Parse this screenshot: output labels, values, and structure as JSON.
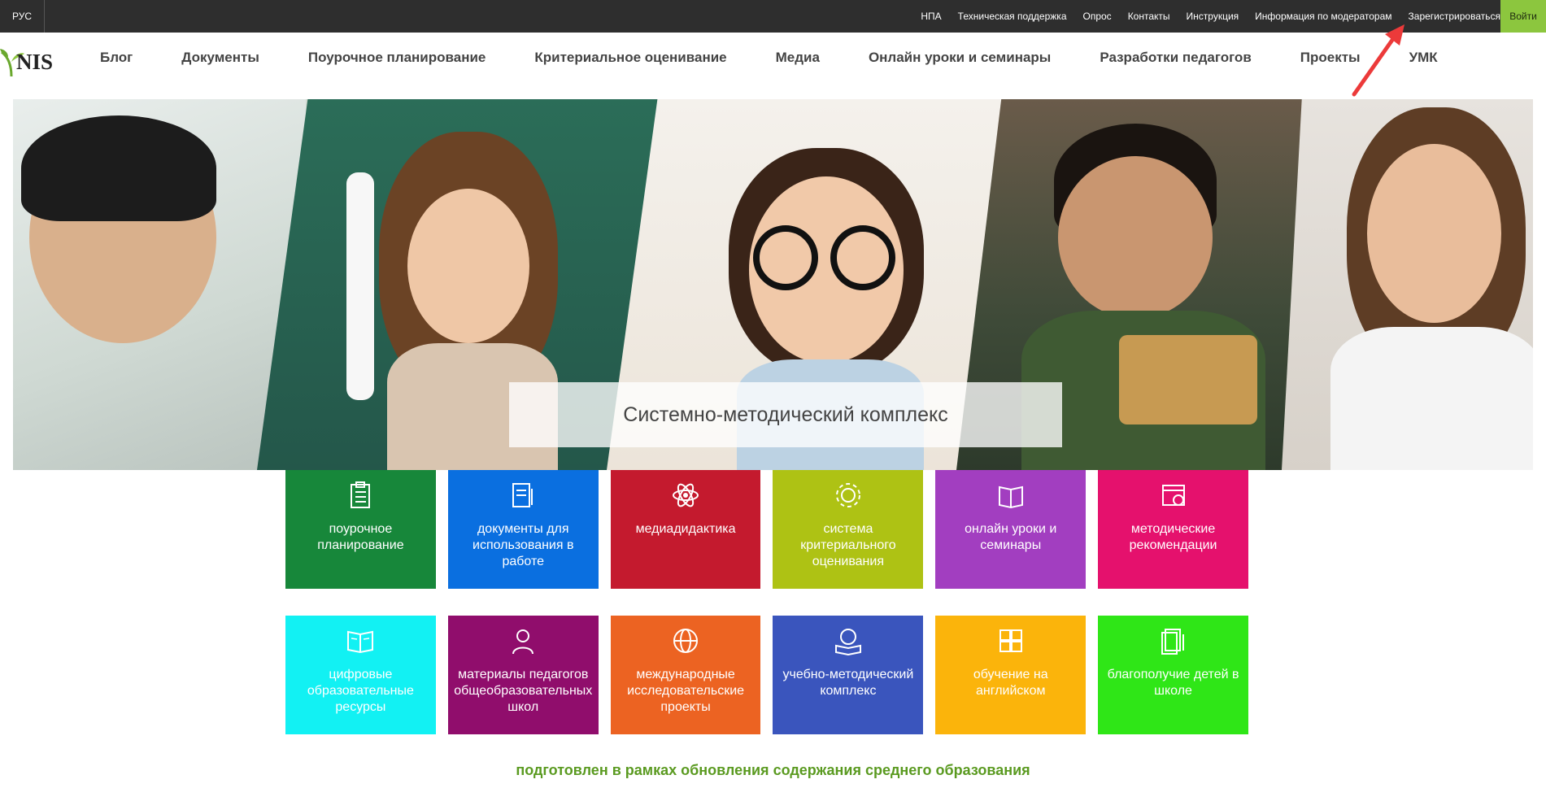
{
  "topbar": {
    "lang": "РУС",
    "links": [
      "НПА",
      "Техническая поддержка",
      "Опрос",
      "Контакты",
      "Инструкция",
      "Информация по модераторам",
      "Зарегистрироваться"
    ],
    "login": "Войти"
  },
  "logo": {
    "text": "NIS"
  },
  "menu": [
    "Блог",
    "Документы",
    "Поурочное планирование",
    "Критериальное оценивание",
    "Медиа",
    "Онлайн уроки и семинары",
    "Разработки педагогов",
    "Проекты",
    "УМК"
  ],
  "hero": {
    "caption": "Системно-методический комплекс"
  },
  "tiles": {
    "row1": [
      {
        "label": "поурочное планирование",
        "icon": "clipboard-icon",
        "color": "#17873a"
      },
      {
        "label": "документы для использования в работе",
        "icon": "documents-icon",
        "color": "#0a6fe0"
      },
      {
        "label": "медиадидактика",
        "icon": "atom-icon",
        "color": "#c41a2e"
      },
      {
        "label": "система критериального оценивания",
        "icon": "gear-icon",
        "color": "#aec214"
      },
      {
        "label": "онлайн уроки и семинары",
        "icon": "book-icon",
        "color": "#a23ec0"
      },
      {
        "label": "методические рекомендации",
        "icon": "calendar-icon",
        "color": "#e5116d"
      }
    ],
    "row2": [
      {
        "label": "цифровые образовательные ресурсы",
        "icon": "open-book-icon",
        "color": "#12f1f3"
      },
      {
        "label": "материалы педагогов общеобразовательных школ",
        "icon": "teacher-icon",
        "color": "#900d6c"
      },
      {
        "label": "международные исследовательские проекты",
        "icon": "globe-icon",
        "color": "#ec6322"
      },
      {
        "label": "учебно-методический комплекс",
        "icon": "brain-book-icon",
        "color": "#3a55bd"
      },
      {
        "label": "обучение на английском",
        "icon": "puzzle-icon",
        "color": "#fbb40b"
      },
      {
        "label": "благополучие детей в школе",
        "icon": "papers-icon",
        "color": "#2fe617"
      }
    ]
  },
  "footer": {
    "note": "подготовлен в рамках обновления содержания среднего образования"
  }
}
